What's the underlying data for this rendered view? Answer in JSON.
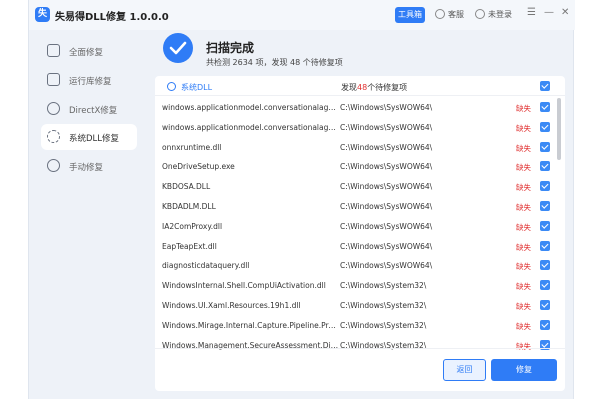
{
  "titlebar": {
    "logo_text": "失",
    "title": "失易得DLL修复 1.0.0.0",
    "toolbox_label": "工具箱",
    "customer_service_label": "客服",
    "login_label": "未登录",
    "menu_icon": "menu-icon",
    "minimize_label": "—",
    "close_label": "✕"
  },
  "sidebar": {
    "items": [
      {
        "label": "全面修复",
        "icon": "monitor-icon"
      },
      {
        "label": "运行库修复",
        "icon": "layers-icon"
      },
      {
        "label": "DirectX修复",
        "icon": "x-circle-icon"
      },
      {
        "label": "系统DLL修复",
        "icon": "gear-icon"
      },
      {
        "label": "手动修复",
        "icon": "wrench-icon"
      }
    ],
    "active_index": 3
  },
  "header": {
    "title": "扫描完成",
    "summary": "共检测 2634 项，发现 48 个待修复项"
  },
  "list": {
    "category_name": "系统DLL",
    "found_prefix": "发现",
    "found_count": "48",
    "found_suffix": "个待修复项",
    "rows": [
      {
        "name": "windows.applicationmodel.conversationalagent.proxy...",
        "path": "C:\\Windows\\SysWOW64\\",
        "status": "缺失"
      },
      {
        "name": "windows.applicationmodel.conversationalagent.intern...",
        "path": "C:\\Windows\\SysWOW64\\",
        "status": "缺失"
      },
      {
        "name": "onnxruntime.dll",
        "path": "C:\\Windows\\SysWOW64\\",
        "status": "缺失"
      },
      {
        "name": "OneDriveSetup.exe",
        "path": "C:\\Windows\\SysWOW64\\",
        "status": "缺失"
      },
      {
        "name": "KBDOSA.DLL",
        "path": "C:\\Windows\\SysWOW64\\",
        "status": "缺失"
      },
      {
        "name": "KBDADLM.DLL",
        "path": "C:\\Windows\\SysWOW64\\",
        "status": "缺失"
      },
      {
        "name": "IA2ComProxy.dll",
        "path": "C:\\Windows\\SysWOW64\\",
        "status": "缺失"
      },
      {
        "name": "EapTeapExt.dll",
        "path": "C:\\Windows\\SysWOW64\\",
        "status": "缺失"
      },
      {
        "name": "diagnosticdataquery.dll",
        "path": "C:\\Windows\\SysWOW64\\",
        "status": "缺失"
      },
      {
        "name": "WindowsInternal.Shell.CompUiActivation.dll",
        "path": "C:\\Windows\\System32\\",
        "status": "缺失"
      },
      {
        "name": "Windows.UI.Xaml.Resources.19h1.dll",
        "path": "C:\\Windows\\System32\\",
        "status": "缺失"
      },
      {
        "name": "Windows.Mirage.Internal.Capture.Pipeline.ProxyStub.dll",
        "path": "C:\\Windows\\System32\\",
        "status": "缺失"
      },
      {
        "name": "Windows.Management.SecureAssessment.Diagnostics...",
        "path": "C:\\Windows\\System32\\",
        "status": "缺失"
      }
    ]
  },
  "footer": {
    "back_label": "返回",
    "repair_label": "修复"
  },
  "colors": {
    "accent": "#2f7cf6",
    "missing": "#e03030"
  }
}
